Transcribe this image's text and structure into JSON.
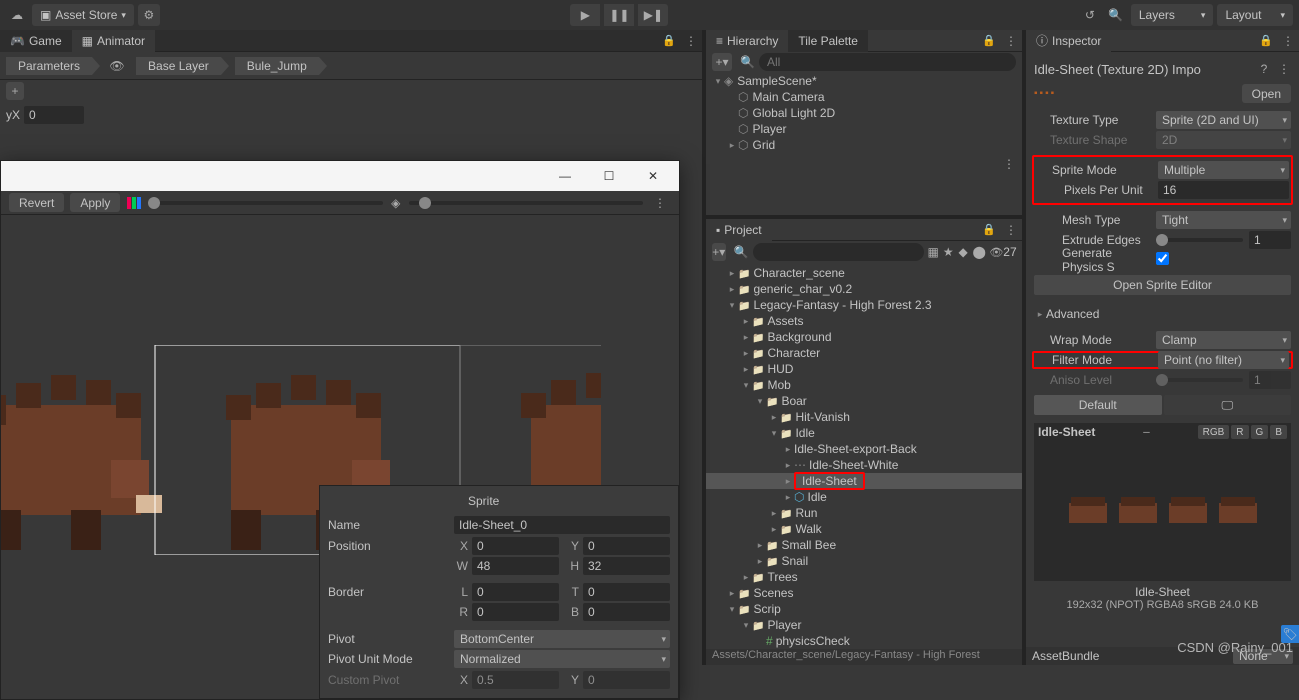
{
  "toolbar": {
    "asset_store": "Asset Store",
    "layers": "Layers",
    "layout": "Layout"
  },
  "left_tabs": {
    "game": "Game",
    "animator": "Animator"
  },
  "animator": {
    "parameters": "Parameters",
    "base_layer": "Base Layer",
    "state": "Bule_Jump",
    "y_label": "yX",
    "y_value": "0"
  },
  "sprite_editor": {
    "revert": "Revert",
    "apply": "Apply",
    "panel_title": "Sprite",
    "name_lbl": "Name",
    "name_val": "Idle-Sheet_0",
    "position_lbl": "Position",
    "x_lbl": "X",
    "x": "0",
    "yy_lbl": "Y",
    "yy": "0",
    "w_lbl": "W",
    "w": "48",
    "h_lbl": "H",
    "h": "32",
    "border_lbl": "Border",
    "l_lbl": "L",
    "l": "0",
    "t_lbl": "T",
    "t": "0",
    "r_lbl": "R",
    "r": "0",
    "b_lbl": "B",
    "b": "0",
    "pivot_lbl": "Pivot",
    "pivot_val": "BottomCenter",
    "pivot_mode_lbl": "Pivot Unit Mode",
    "pivot_mode_val": "Normalized",
    "custom_pivot_lbl": "Custom Pivot",
    "cpx_lbl": "X",
    "cpx": "0.5",
    "cpy_lbl": "Y",
    "cpy": "0"
  },
  "hierarchy": {
    "title": "Hierarchy",
    "tile_palette": "Tile Palette",
    "search_ph": "All",
    "items": [
      {
        "label": "SampleScene*",
        "indent": 0,
        "caret": "▾",
        "icon": "unity"
      },
      {
        "label": "Main Camera",
        "indent": 1,
        "icon": "cube"
      },
      {
        "label": "Global Light 2D",
        "indent": 1,
        "icon": "cube"
      },
      {
        "label": "Player",
        "indent": 1,
        "icon": "cube"
      },
      {
        "label": "Grid",
        "indent": 1,
        "caret": "▸",
        "icon": "cube"
      }
    ]
  },
  "project": {
    "title": "Project",
    "visible_count": "27",
    "items": [
      {
        "label": "Character_scene",
        "indent": 1,
        "caret": "▸"
      },
      {
        "label": "generic_char_v0.2",
        "indent": 1,
        "caret": "▸"
      },
      {
        "label": "Legacy-Fantasy - High Forest 2.3",
        "indent": 1,
        "caret": "▾"
      },
      {
        "label": "Assets",
        "indent": 2,
        "caret": "▸"
      },
      {
        "label": "Background",
        "indent": 2,
        "caret": "▸"
      },
      {
        "label": "Character",
        "indent": 2,
        "caret": "▸"
      },
      {
        "label": "HUD",
        "indent": 2,
        "caret": "▸"
      },
      {
        "label": "Mob",
        "indent": 2,
        "caret": "▾"
      },
      {
        "label": "Boar",
        "indent": 3,
        "caret": "▾"
      },
      {
        "label": "Hit-Vanish",
        "indent": 4,
        "caret": "▸"
      },
      {
        "label": "Idle",
        "indent": 4,
        "caret": "▾"
      },
      {
        "label": "Idle-Sheet-export-Back",
        "indent": 5,
        "caret": "▸",
        "noicon": true
      },
      {
        "label": "Idle-Sheet-White",
        "indent": 5,
        "caret": "▸",
        "noicon": true,
        "dots": true
      },
      {
        "label": "Idle-Sheet",
        "indent": 5,
        "caret": "▸",
        "noicon": true,
        "sel": true,
        "hl": true
      },
      {
        "label": "Idle",
        "indent": 5,
        "caret": "▸",
        "icon": "prefab"
      },
      {
        "label": "Run",
        "indent": 4,
        "caret": "▸"
      },
      {
        "label": "Walk",
        "indent": 4,
        "caret": "▸"
      },
      {
        "label": "Small Bee",
        "indent": 3,
        "caret": "▸"
      },
      {
        "label": "Snail",
        "indent": 3,
        "caret": "▸"
      },
      {
        "label": "Trees",
        "indent": 2,
        "caret": "▸"
      },
      {
        "label": "Scenes",
        "indent": 1,
        "caret": "▸"
      },
      {
        "label": "Scrip",
        "indent": 1,
        "caret": "▾"
      },
      {
        "label": "Player",
        "indent": 2,
        "caret": "▾"
      },
      {
        "label": "physicsCheck",
        "indent": 3,
        "icon": "cs",
        "caret": ""
      }
    ],
    "footer": "Assets/Character_scene/Legacy-Fantasy - High Forest"
  },
  "inspector": {
    "title": "Inspector",
    "asset": "Idle-Sheet (Texture 2D) Impo",
    "open": "Open",
    "texture_type_lbl": "Texture Type",
    "texture_type": "Sprite (2D and UI)",
    "texture_shape_lbl": "Texture Shape",
    "texture_shape": "2D",
    "sprite_mode_lbl": "Sprite Mode",
    "sprite_mode": "Multiple",
    "ppu_lbl": "Pixels Per Unit",
    "ppu": "16",
    "mesh_type_lbl": "Mesh Type",
    "mesh_type": "Tight",
    "extrude_lbl": "Extrude Edges",
    "extrude": "1",
    "gen_phys_lbl": "Generate Physics S",
    "open_editor": "Open Sprite Editor",
    "advanced": "Advanced",
    "wrap_lbl": "Wrap Mode",
    "wrap": "Clamp",
    "filter_lbl": "Filter Mode",
    "filter": "Point (no filter)",
    "aniso_lbl": "Aniso Level",
    "aniso": "1",
    "default": "Default",
    "preview_name": "Idle-Sheet",
    "rgb": "RGB",
    "r": "R",
    "g": "G",
    "b": "B",
    "dims": "192x32 (NPOT)  RGBA8 sRGB  24.0 KB",
    "assetbundle_lbl": "AssetBundle",
    "assetbundle_none": "None"
  },
  "watermark": "CSDN @Rainy_001"
}
